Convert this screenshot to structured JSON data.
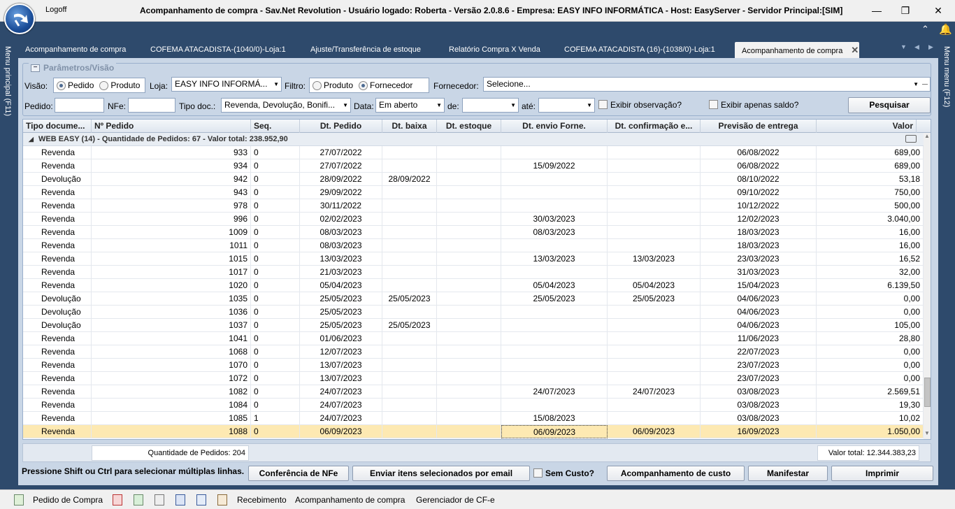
{
  "app": {
    "logoff": "Logoff",
    "title": "Acompanhamento de compra - Sav.Net Revolution - Usuário logado: Roberta - Versão 2.0.8.6 - Empresa: EASY INFO INFORMÁTICA - Host: EasyServer - Servidor Principal:[SIM]",
    "menu_left": "Menu principal (F11)",
    "menu_right": "Menu menu (F12)"
  },
  "tabs": [
    {
      "label": "Acompanhamento de compra"
    },
    {
      "label": "COFEMA ATACADISTA-(1040/0)-Loja:1"
    },
    {
      "label": "Ajuste/Transferência de estoque"
    },
    {
      "label": "Relatório Compra X Venda"
    },
    {
      "label": "COFEMA ATACADISTA (16)-(1038/0)-Loja:1"
    },
    {
      "label": "Acompanhamento de compra"
    }
  ],
  "params": {
    "header": "Parâmetros/Visão",
    "visao_label": "Visão:",
    "visao_opt1": "Pedido",
    "visao_opt2": "Produto",
    "loja_label": "Loja:",
    "loja_value": "EASY INFO INFORMÁ...",
    "filtro_label": "Filtro:",
    "filtro_opt1": "Produto",
    "filtro_opt2": "Fornecedor",
    "fornecedor_label": "Fornecedor:",
    "fornecedor_value": "Selecione...",
    "pedido_label": "Pedido:",
    "pedido_value": "",
    "nfe_label": "NFe:",
    "nfe_value": "",
    "tipodoc_label": "Tipo doc.:",
    "tipodoc_value": "Revenda, Devolução, Bonifi...",
    "data_label": "Data:",
    "data_value": "Em aberto",
    "de_label": "de:",
    "de_value": "",
    "ate_label": "até:",
    "ate_value": "",
    "obs_label": "Exibir observação?",
    "saldo_label": "Exibir apenas saldo?",
    "pesquisar": "Pesquisar"
  },
  "grid": {
    "columns": [
      "Tipo docume...",
      "Nº Pedido",
      "Seq.",
      "Dt. Pedido",
      "Dt. baixa",
      "Dt. estoque",
      "Dt. envio Forne.",
      "Dt. confirmação e...",
      "Previsão de entrega",
      "Valor"
    ],
    "group": "WEB EASY (14) - Quantidade de Pedidos: 67  -  Valor total: 238.952,90",
    "rows": [
      [
        "Revenda",
        "933",
        "0",
        "27/07/2022",
        "",
        "",
        "",
        "",
        "06/08/2022",
        "689,00"
      ],
      [
        "Revenda",
        "934",
        "0",
        "27/07/2022",
        "",
        "",
        "15/09/2022",
        "",
        "06/08/2022",
        "689,00"
      ],
      [
        "Devolução",
        "942",
        "0",
        "28/09/2022",
        "28/09/2022",
        "",
        "",
        "",
        "08/10/2022",
        "53,18"
      ],
      [
        "Revenda",
        "943",
        "0",
        "29/09/2022",
        "",
        "",
        "",
        "",
        "09/10/2022",
        "750,00"
      ],
      [
        "Revenda",
        "978",
        "0",
        "30/11/2022",
        "",
        "",
        "",
        "",
        "10/12/2022",
        "500,00"
      ],
      [
        "Revenda",
        "996",
        "0",
        "02/02/2023",
        "",
        "",
        "30/03/2023",
        "",
        "12/02/2023",
        "3.040,00"
      ],
      [
        "Revenda",
        "1009",
        "0",
        "08/03/2023",
        "",
        "",
        "08/03/2023",
        "",
        "18/03/2023",
        "16,00"
      ],
      [
        "Revenda",
        "1011",
        "0",
        "08/03/2023",
        "",
        "",
        "",
        "",
        "18/03/2023",
        "16,00"
      ],
      [
        "Revenda",
        "1015",
        "0",
        "13/03/2023",
        "",
        "",
        "13/03/2023",
        "13/03/2023",
        "23/03/2023",
        "16,52"
      ],
      [
        "Revenda",
        "1017",
        "0",
        "21/03/2023",
        "",
        "",
        "",
        "",
        "31/03/2023",
        "32,00"
      ],
      [
        "Revenda",
        "1020",
        "0",
        "05/04/2023",
        "",
        "",
        "05/04/2023",
        "05/04/2023",
        "15/04/2023",
        "6.139,50"
      ],
      [
        "Devolução",
        "1035",
        "0",
        "25/05/2023",
        "25/05/2023",
        "",
        "25/05/2023",
        "25/05/2023",
        "04/06/2023",
        "0,00"
      ],
      [
        "Devolução",
        "1036",
        "0",
        "25/05/2023",
        "",
        "",
        "",
        "",
        "04/06/2023",
        "0,00"
      ],
      [
        "Devolução",
        "1037",
        "0",
        "25/05/2023",
        "25/05/2023",
        "",
        "",
        "",
        "04/06/2023",
        "105,00"
      ],
      [
        "Revenda",
        "1041",
        "0",
        "01/06/2023",
        "",
        "",
        "",
        "",
        "11/06/2023",
        "28,80"
      ],
      [
        "Revenda",
        "1068",
        "0",
        "12/07/2023",
        "",
        "",
        "",
        "",
        "22/07/2023",
        "0,00"
      ],
      [
        "Revenda",
        "1070",
        "0",
        "13/07/2023",
        "",
        "",
        "",
        "",
        "23/07/2023",
        "0,00"
      ],
      [
        "Revenda",
        "1072",
        "0",
        "13/07/2023",
        "",
        "",
        "",
        "",
        "23/07/2023",
        "0,00"
      ],
      [
        "Revenda",
        "1082",
        "0",
        "24/07/2023",
        "",
        "",
        "24/07/2023",
        "24/07/2023",
        "03/08/2023",
        "2.569,51"
      ],
      [
        "Revenda",
        "1084",
        "0",
        "24/07/2023",
        "",
        "",
        "",
        "",
        "03/08/2023",
        "19,30"
      ],
      [
        "Revenda",
        "1085",
        "1",
        "24/07/2023",
        "",
        "",
        "15/08/2023",
        "",
        "03/08/2023",
        "10,02"
      ],
      [
        "Revenda",
        "1088",
        "0",
        "06/09/2023",
        "",
        "",
        "06/09/2023",
        "06/09/2023",
        "16/09/2023",
        "1.050,00"
      ]
    ],
    "selected_index": 21,
    "qtd_pedidos": "Quantidade de Pedidos: 204",
    "valor_total": "Valor total: 12.344.383,23"
  },
  "bottom": {
    "hint": "Pressione Shift ou Ctrl para selecionar múltiplas linhas.",
    "conferencia": "Conferência de NFe",
    "enviar": "Enviar itens selecionados por email",
    "sem_custo": "Sem Custo?",
    "acomp_custo": "Acompanhamento de custo",
    "manifestar": "Manifestar",
    "imprimir": "Imprimir"
  },
  "statusbar": {
    "pedido": "Pedido de Compra",
    "recebimento": "Recebimento",
    "acompanhamento": "Acompanhamento de compra",
    "gerenciador": "Gerenciador de CF-e"
  }
}
